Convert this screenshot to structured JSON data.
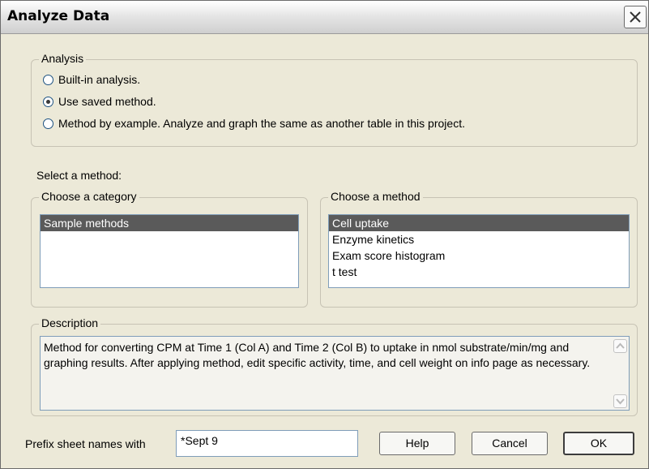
{
  "window": {
    "title": "Analyze Data"
  },
  "analysis": {
    "legend": "Analysis",
    "options": [
      {
        "label": "Built-in analysis.",
        "checked": false
      },
      {
        "label": "Use saved method.",
        "checked": true
      },
      {
        "label": "Method by example. Analyze and graph the same as another table in this project.",
        "checked": false
      }
    ]
  },
  "select_method": {
    "label": "Select a method:"
  },
  "category": {
    "legend": "Choose a category",
    "items": [
      "Sample methods"
    ],
    "selected": "Sample methods"
  },
  "method": {
    "legend": "Choose a method",
    "items": [
      "Cell uptake",
      "Enzyme kinetics",
      "Exam score histogram",
      "t test"
    ],
    "selected": "Cell uptake"
  },
  "description": {
    "legend": "Description",
    "text": "Method for converting CPM at Time 1 (Col A) and Time 2 (Col B) to uptake in  nmol substrate/min/mg and graphing results. After applying method, edit specific activity, time, and cell weight on info page as necessary."
  },
  "prefix": {
    "label": "Prefix sheet names with",
    "value": "*Sept 9"
  },
  "buttons": {
    "help": "Help",
    "cancel": "Cancel",
    "ok": "OK"
  }
}
